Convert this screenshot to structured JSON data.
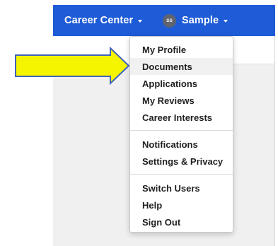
{
  "navbar": {
    "career_center": "Career Center",
    "user_initials": "SS",
    "user_name": "Sample"
  },
  "menu": {
    "items": [
      "My Profile",
      "Documents",
      "Applications",
      "My Reviews",
      "Career Interests",
      "Notifications",
      "Settings & Privacy",
      "Switch Users",
      "Help",
      "Sign Out"
    ],
    "highlighted_item": "Documents"
  },
  "colors": {
    "navbar": "#1e5bd6",
    "arrow_fill": "#f5f500",
    "arrow_stroke": "#3f63b8"
  },
  "icons": {
    "callout": "arrow-right-icon",
    "dropdown_caret": "caret-down-icon"
  }
}
